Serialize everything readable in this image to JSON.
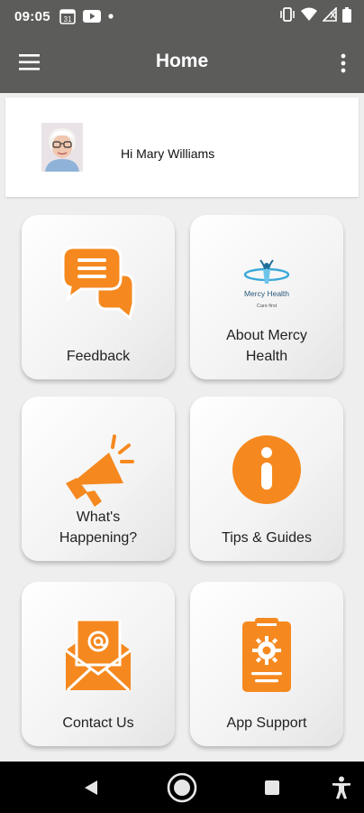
{
  "status_bar": {
    "time": "09:05",
    "left_icons": [
      "calendar-icon",
      "youtube-icon",
      "dot-icon"
    ],
    "right_icons": [
      "vibrate-icon",
      "wifi-icon",
      "signal-icon",
      "battery-icon"
    ],
    "calendar_day": "31"
  },
  "app_bar": {
    "title": "Home",
    "menu_icon": "hamburger-menu-icon",
    "more_icon": "more-vert-icon"
  },
  "greeting": {
    "text": "Hi Mary Williams"
  },
  "tiles": [
    {
      "label": "Feedback",
      "icon": "chat-bubbles-icon"
    },
    {
      "label": "About Mercy Health",
      "icon": "mercy-health-logo"
    },
    {
      "label": "What's Happening?",
      "icon": "megaphone-icon"
    },
    {
      "label": "Tips & Guides",
      "icon": "info-icon"
    },
    {
      "label": "Contact Us",
      "icon": "email-envelope-icon"
    },
    {
      "label": "App Support",
      "icon": "phone-settings-icon"
    }
  ],
  "logo_text": {
    "brand": "Mercy Health",
    "tagline": "Care first"
  },
  "nav_bar": [
    "back-icon",
    "home-icon",
    "recents-icon",
    "accessibility-icon"
  ],
  "colors": {
    "accent": "#f5891f",
    "app_bar": "#5c5d5b"
  }
}
